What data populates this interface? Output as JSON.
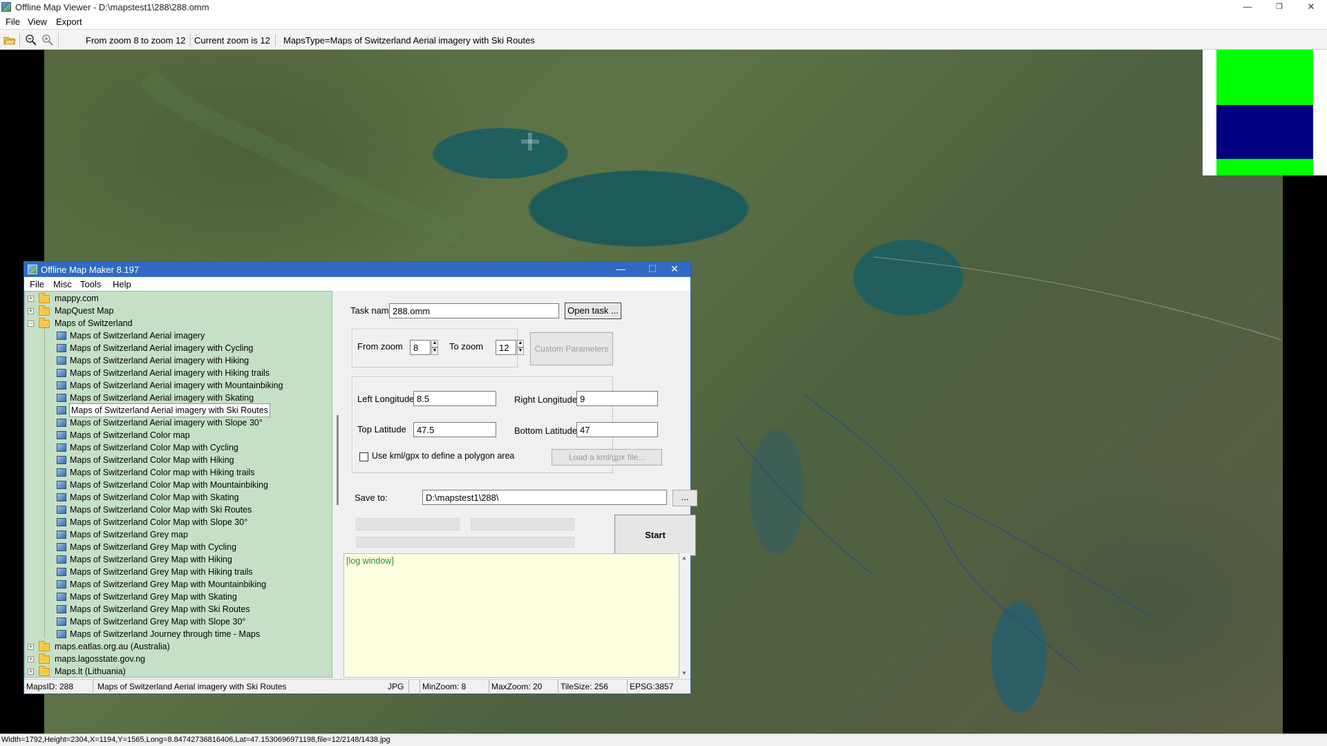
{
  "window": {
    "title": "Offline Map Viewer - D:\\mapstest1\\288\\288.omm",
    "minimize": "—",
    "maximize": "❐",
    "close": "✕"
  },
  "menubar": [
    "File",
    "View",
    "Export"
  ],
  "toolbar": {
    "zoom_range": "From zoom 8 to zoom 12",
    "current_zoom": "Current zoom is 12",
    "maps_type": "MapsType=Maps of Switzerland Aerial imagery with Ski Routes"
  },
  "statusbar": "Width=1792,Height=2304,X=1194,Y=1565,Long=8.84742736816406,Lat=47.1530696971198,file=12/2148/1438.jpg",
  "overview_colors": {
    "top": "#00ff00",
    "middle": "#000080",
    "bottom": "#00ff00"
  },
  "dialog": {
    "title": "Offline Map Maker 8.197",
    "menu": [
      "File",
      "Misc",
      "Tools",
      "Help"
    ],
    "tree": {
      "top_items": [
        {
          "label": "mappy.com",
          "expanded": false
        },
        {
          "label": "MapQuest Map",
          "expanded": false
        },
        {
          "label": "Maps of Switzerland",
          "expanded": true
        }
      ],
      "children": [
        "Maps of Switzerland Aerial imagery",
        "Maps of Switzerland Aerial imagery with Cycling",
        "Maps of Switzerland Aerial imagery with Hiking",
        "Maps of Switzerland Aerial imagery with Hiking trails",
        "Maps of Switzerland Aerial imagery with Mountainbiking",
        "Maps of Switzerland Aerial imagery with Skating",
        "Maps of Switzerland Aerial imagery with Ski Routes",
        "Maps of Switzerland Aerial imagery with Slope 30°",
        "Maps of Switzerland Color map",
        "Maps of Switzerland Color Map with Cycling",
        "Maps of Switzerland Color Map with Hiking",
        "Maps of Switzerland Color map with Hiking trails",
        "Maps of Switzerland Color Map with Mountainbiking",
        "Maps of Switzerland Color Map with Skating",
        "Maps of Switzerland Color Map with Ski Routes",
        "Maps of Switzerland Color Map with Slope 30°",
        "Maps of Switzerland Grey map",
        "Maps of Switzerland Grey Map with Cycling",
        "Maps of Switzerland Grey Map with Hiking",
        "Maps of Switzerland Grey Map with Hiking trails",
        "Maps of Switzerland Grey Map with Mountainbiking",
        "Maps of Switzerland Grey Map with Skating",
        "Maps of Switzerland Grey Map with Ski Routes",
        "Maps of Switzerland Grey Map with Slope 30°",
        "Maps of Switzerland Journey through time - Maps"
      ],
      "selected": "Maps of Switzerland Aerial imagery with Ski Routes",
      "bottom_items": [
        {
          "label": "maps.eatlas.org.au (Australia)"
        },
        {
          "label": "maps.lagosstate.gov.ng"
        },
        {
          "label": "Maps.lt (Lithuania)"
        }
      ]
    },
    "form": {
      "task_name_label": "Task name",
      "task_name_value": "288.omm",
      "open_task_label": "Open task ...",
      "from_zoom_label": "From zoom",
      "from_zoom_value": "8",
      "to_zoom_label": "To zoom",
      "to_zoom_value": "12",
      "custom_params_label": "Custom Parameters",
      "left_lon_label": "Left Longitude",
      "left_lon_value": "8.5",
      "right_lon_label": "Right Longitude",
      "right_lon_value": "9",
      "top_lat_label": "Top Latitude",
      "top_lat_value": "47.5",
      "bottom_lat_label": "Bottom Latitude",
      "bottom_lat_value": "47",
      "kml_checkbox_label": "Use kml/gpx to define a polygon area",
      "kml_checked": false,
      "load_kml_label": "Load a kml/gpx file...",
      "save_to_label": "Save to:",
      "save_to_value": "D:\\mapstest1\\288\\",
      "browse_label": "...",
      "start_label": "Start",
      "progress": [
        0,
        0,
        0
      ]
    },
    "log_text": "[log window]",
    "status": {
      "maps_id": "MapsID: 288",
      "maps_name": "Maps of Switzerland Aerial imagery with Ski Routes",
      "format": "JPG",
      "min_zoom": "MinZoom: 8",
      "max_zoom": "MaxZoom: 20",
      "tile_size": "TileSize: 256",
      "epsg": "EPSG:3857"
    }
  }
}
